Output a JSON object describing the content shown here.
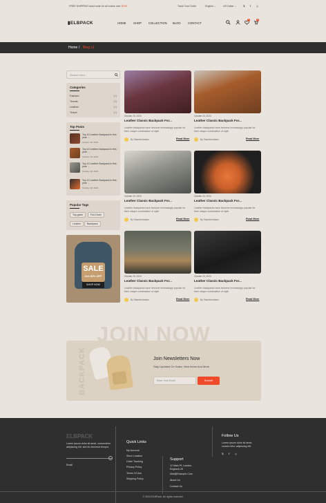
{
  "topbar": {
    "promo_prefix": "FREE SHIPPING world wide for all orders over ",
    "promo_amount": "$199",
    "track": "Track Your Order",
    "language": "English",
    "currency": "US Dollar"
  },
  "brand": {
    "logo": "ELBPACK"
  },
  "nav": [
    "HOME",
    "SHOP",
    "COLLECTION",
    "BLOG",
    "CONTACT"
  ],
  "header_counts": {
    "wishlist": "0",
    "cart": "0"
  },
  "breadcrumb": {
    "home": "Home",
    "current": "Blog v1"
  },
  "search": {
    "placeholder": "Search here..."
  },
  "categories": {
    "title": "Categories",
    "items": [
      {
        "label": "Fashion",
        "count": "(1)"
      },
      {
        "label": "Trends",
        "count": "(3)"
      },
      {
        "label": "Leather",
        "count": "(1)"
      },
      {
        "label": "Travel",
        "count": "(1)"
      }
    ]
  },
  "top_posts": {
    "title": "Top Posts",
    "items": [
      {
        "title": "Top 10 Leather Backpack in this year ...",
        "date": "October 18, 2024"
      },
      {
        "title": "Top 10 Leather Backpack in this year ...",
        "date": "October 18, 2024"
      },
      {
        "title": "Top 10 Leather Backpack in this year ...",
        "date": "October 18, 2024"
      },
      {
        "title": "Top 10 Leather Backpack in this year ...",
        "date": "October 18, 2024"
      }
    ]
  },
  "popular_tags": {
    "title": "Popular Tags",
    "items": [
      "Top-grain",
      "Full-Grain",
      "Leather",
      "Backpack"
    ]
  },
  "promo": {
    "sale": "SALE",
    "discount": "Get 30% OFF",
    "cta": "SHOP NOW"
  },
  "posts": [
    {
      "date": "October 20, 2024",
      "title": "Leather Classic Backpack For...",
      "desc": "Leather backpacks have become increasingly popular for their unique combination of style",
      "author": "By Shamimuhalam",
      "read": "Read More"
    },
    {
      "date": "October 20, 2024",
      "title": "Leather Classic Backpack For...",
      "desc": "Leather backpacks have become increasingly popular for their unique combination of style",
      "author": "By Shamimuhalam",
      "read": "Read More"
    },
    {
      "date": "October 20, 2024",
      "title": "Leather Classic Backpack For...",
      "desc": "Leather backpacks have become increasingly popular for their unique combination of style",
      "author": "By Shamimuhalam",
      "read": "Read More"
    },
    {
      "date": "October 20, 2024",
      "title": "Leather Classic Backpack For...",
      "desc": "Leather backpacks have become increasingly popular for their unique combination of style",
      "author": "By Shamimuhalam",
      "read": "Read More"
    },
    {
      "date": "October 20, 2024",
      "title": "Leather Classic Backpack For...",
      "desc": "Leather backpacks have become increasingly popular for their unique combination of style",
      "author": "By Shamimuhalam",
      "read": "Read More"
    },
    {
      "date": "October 20, 2024",
      "title": "Leather Classic Backpack For...",
      "desc": "Leather backpacks have become increasingly popular for their unique combination of style",
      "author": "By Shamimuhalam",
      "read": "Read More"
    }
  ],
  "newsletter": {
    "bg_text": "JOIN NOW",
    "side_text": "BACKPACK",
    "title": "Join Newsletters Now",
    "sub": "Stay Updated On Sales, New Items And More",
    "placeholder": "Enter Your Email",
    "button": "Submit"
  },
  "footer": {
    "logo": "ELBPACK",
    "about": "Lorem ipsum dolor sit amet, consectetur adipiscing elit, sed do eiusmod tempor.",
    "email_label": "Email",
    "quick_title": "Quick Links",
    "quick": [
      "My Account",
      "Store Location",
      "Order Tracking",
      "Privacy Policy",
      "Terms Of Use",
      "Shipping Policy"
    ],
    "support_title": "Support",
    "address": "12 Main Pt, London, England,UK",
    "mail": "Mail@Example.Com",
    "support_links": [
      "About Us",
      "Contact Us"
    ],
    "follow_title": "Follow Us",
    "follow_text": "Lorem ipsum dolor sit amet, consec tetur adipiscing elit.",
    "copyright": "© 2024 ELBPack. All rights reserved."
  },
  "colors": {
    "accent": "#ef4a2a",
    "dark": "#2f2f2f",
    "bg": "#e9e4de",
    "panel": "#ded6cc"
  }
}
